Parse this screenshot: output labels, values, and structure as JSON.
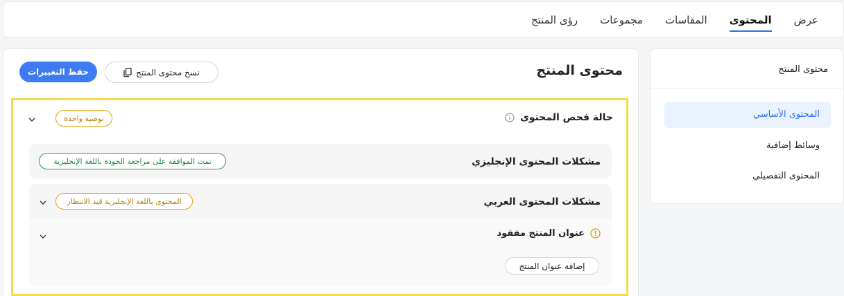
{
  "tabs": [
    {
      "label": "عرض",
      "active": false
    },
    {
      "label": "المحتوى",
      "active": true
    },
    {
      "label": "المقاسات",
      "active": false
    },
    {
      "label": "مجموعات",
      "active": false
    },
    {
      "label": "رؤى المنتج",
      "active": false
    }
  ],
  "sidebar": {
    "title": "محتوى المنتج",
    "items": [
      {
        "label": "المحتوى الأساسي",
        "active": true
      },
      {
        "label": "وسائط إضافية",
        "active": false
      },
      {
        "label": "المحتوى التفصيلي",
        "active": false
      }
    ]
  },
  "main": {
    "title": "محتوى المنتج",
    "copy_button": "نسخ محتوى المنتج",
    "copy_icon": "copy-icon",
    "save_button": "حفظ التغييرات",
    "content_check": {
      "label": "حالة فحص المحتوى",
      "icon": "info-icon",
      "badge": "توصية واحدة"
    },
    "english_issues": {
      "title": "مشكلات المحتوى الإنجليزي",
      "badge": "تمت الموافقة على مراجعة الجودة باللغة الإنجليزية"
    },
    "arabic_issues": {
      "title": "مشكلات المحتوى العربي",
      "badge": "المحتوى باللغة الإنجليزية قيد الانتظار",
      "issue": {
        "label": "عنوان المنتج مفقود",
        "icon": "warning-icon",
        "action": "إضافة عنوان المنتج"
      }
    }
  },
  "colors": {
    "accent": "#2f6fed",
    "save_button": "#3d7bf2",
    "highlight_frame": "#f6d94b",
    "badge_orange": "#e5a100",
    "badge_green": "#2e9a54",
    "sidebar_active_bg": "#e9f2fd"
  }
}
